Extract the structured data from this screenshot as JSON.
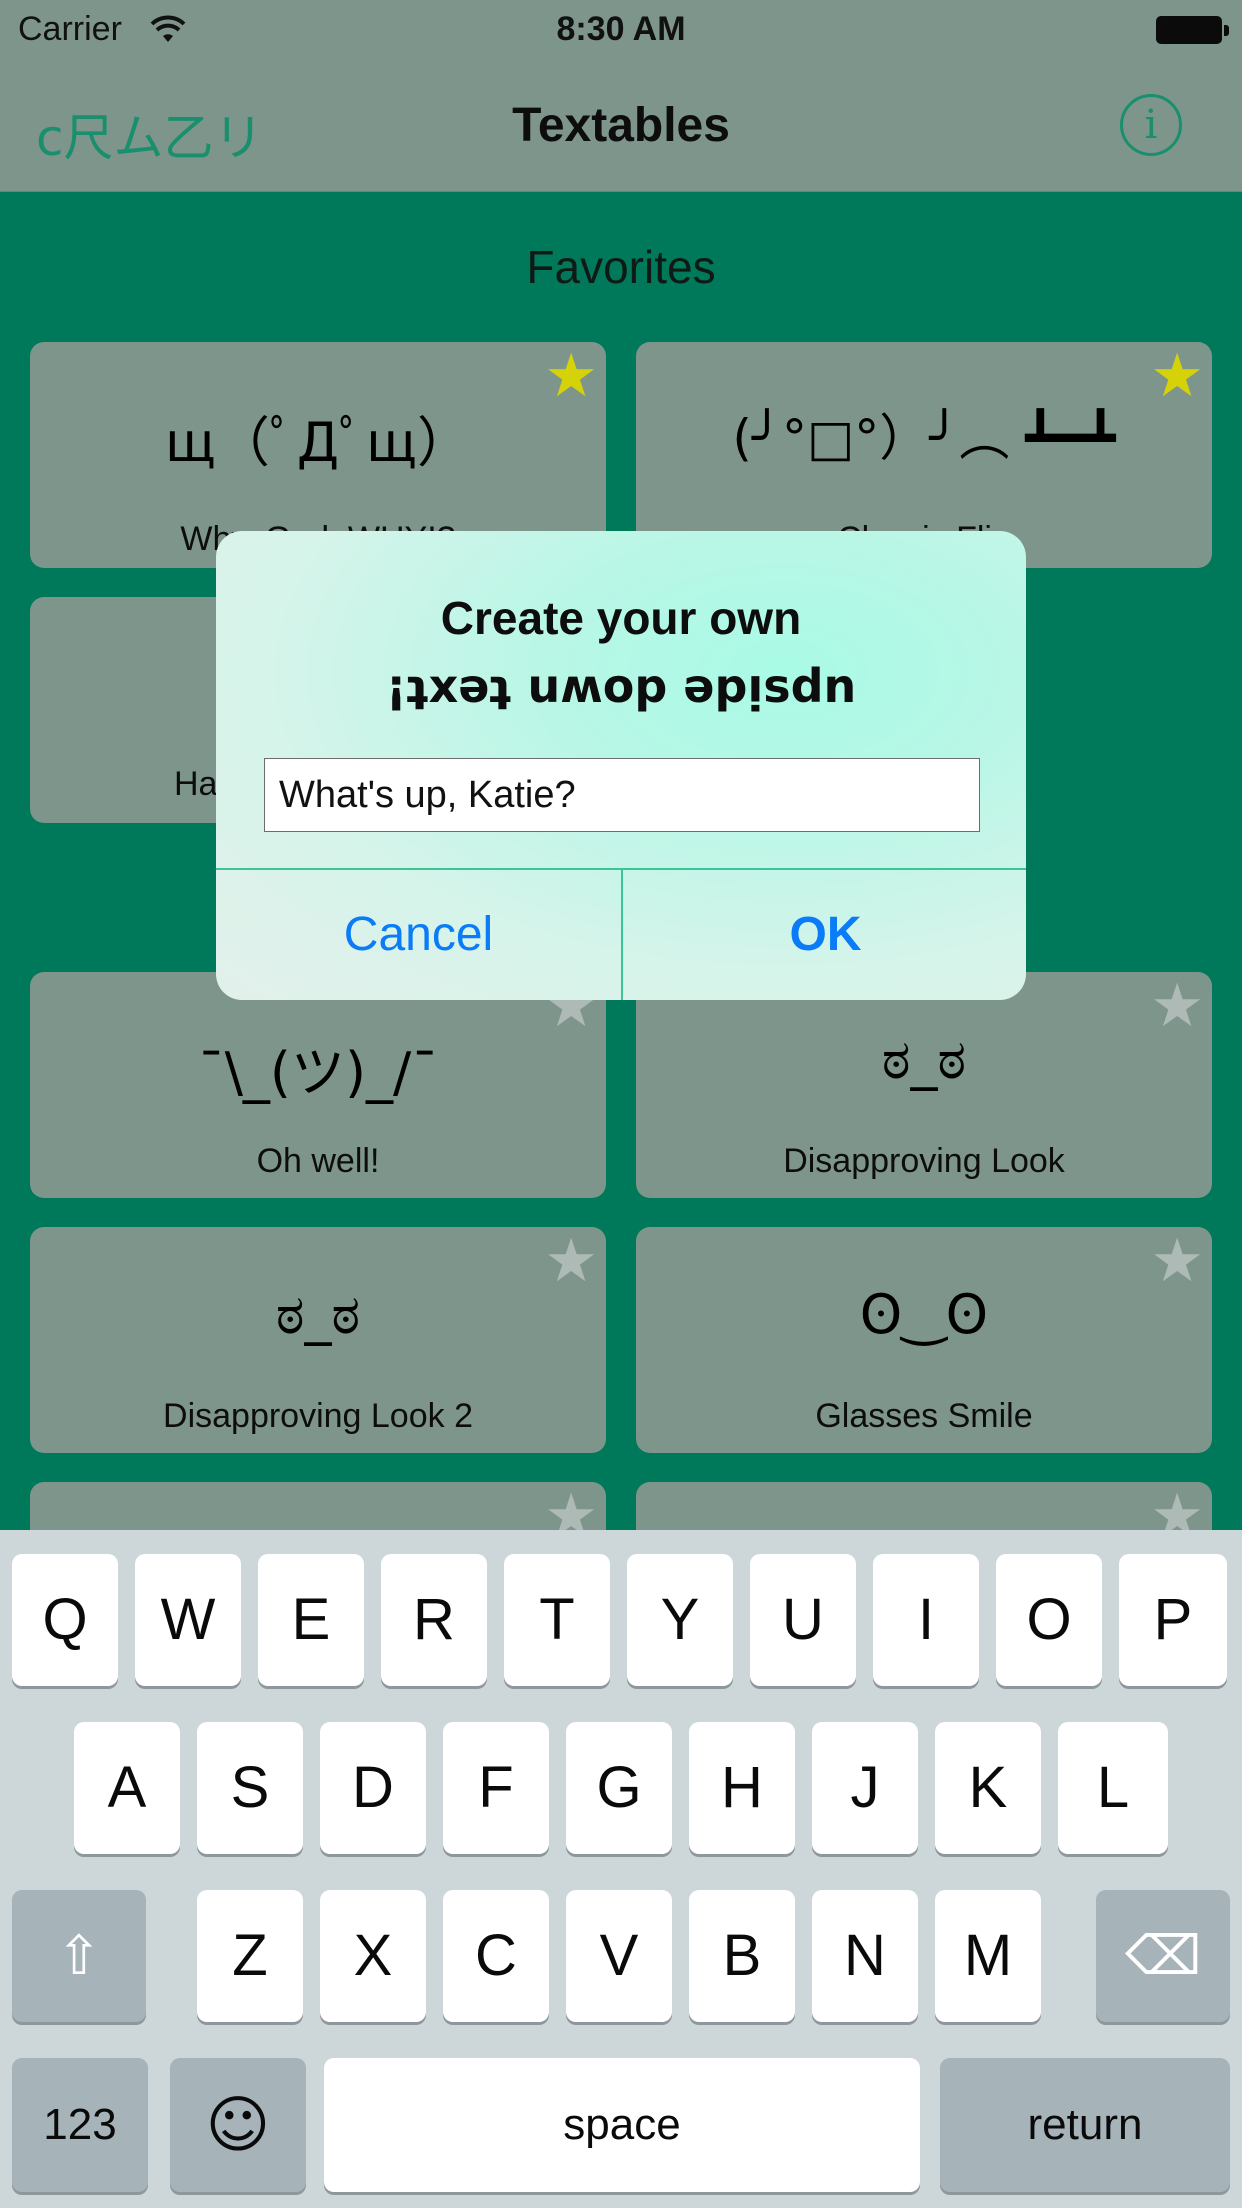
{
  "status_bar": {
    "carrier": "Carrier",
    "time": "8:30 AM"
  },
  "nav": {
    "brand": "c尺ム乙リ",
    "title": "Textables",
    "info_icon": "i"
  },
  "section_title": "Favorites",
  "cards": [
    {
      "face": "щ（ﾟДﾟщ）",
      "name": "Why, God, WHY!?",
      "favorite": true
    },
    {
      "face": "(╯°□°）╯︵ ┻━┻",
      "name": "Classic Flip",
      "favorite": true
    },
    {
      "face": "",
      "name": "Ha",
      "favorite": false
    },
    {
      "face": "¯\\_(ツ)_/¯",
      "name": "Oh well!",
      "favorite": false
    },
    {
      "face": "ಠ_ಠ",
      "name": "Disapproving Look",
      "favorite": false
    },
    {
      "face": "ಠ_ಠ",
      "name": "Disapproving Look 2",
      "favorite": false
    },
    {
      "face": "ʘ‿ʘ",
      "name": "Glasses Smile",
      "favorite": false
    }
  ],
  "star_glyph": "★",
  "alert": {
    "title": "Create your own",
    "subtitle": "¡ʇxǝʇ uʍop ǝpᴉsdn",
    "input_value": "What's up, Katie?",
    "cancel_label": "Cancel",
    "ok_label": "OK"
  },
  "keyboard": {
    "row1": [
      "Q",
      "W",
      "E",
      "R",
      "T",
      "Y",
      "U",
      "I",
      "O",
      "P"
    ],
    "row2": [
      "A",
      "S",
      "D",
      "F",
      "G",
      "H",
      "J",
      "K",
      "L"
    ],
    "row3": [
      "Z",
      "X",
      "C",
      "V",
      "B",
      "N",
      "M"
    ],
    "shift_icon": "⇧",
    "delete_icon": "⌫",
    "numbers_label": "123",
    "emoji_icon": "☺",
    "space_label": "space",
    "return_label": "return"
  }
}
